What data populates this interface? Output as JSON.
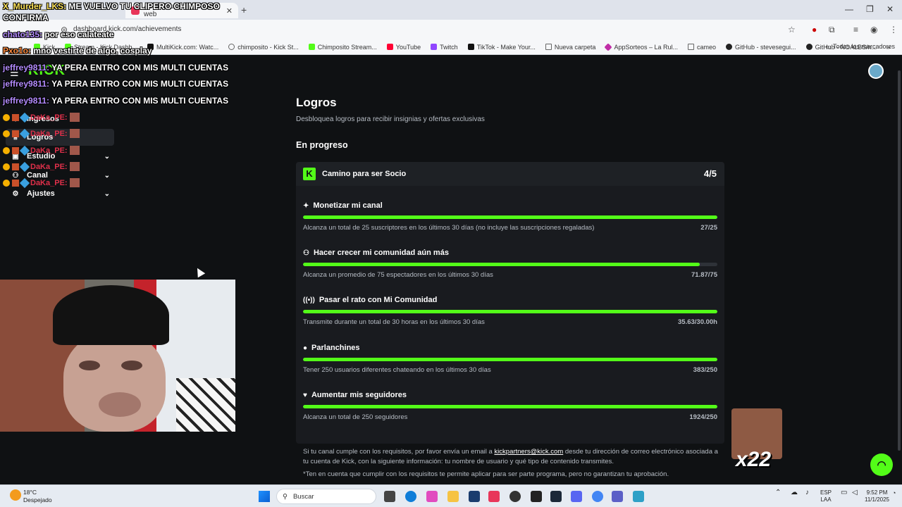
{
  "browser": {
    "active_tab_title": "Apple Music reproductor web",
    "url": "dashboard.kick.com/achievements",
    "bookmarks": [
      "Kick",
      "Stream - Kick Dashb...",
      "MultiKick.com: Watc...",
      "chimposito - Kick St...",
      "Chimposito Stream...",
      "YouTube",
      "Twitch",
      "TikTok - Make Your...",
      "Nueva carpeta",
      "AppSorteos – La Rul...",
      "cameo",
      "GitHub - stevesegui...",
      "GitHub - NOALBS/n..."
    ],
    "all_bookmarks": "Todos los marcadores"
  },
  "sidebar": {
    "items": [
      {
        "label": "Ingresos",
        "icon": "dollar-icon"
      },
      {
        "label": "Logros",
        "icon": "trophy-icon"
      },
      {
        "label": "Estudio",
        "icon": "studio-icon"
      },
      {
        "label": "Canal",
        "icon": "channel-icon"
      },
      {
        "label": "Ajustes",
        "icon": "gear-icon"
      }
    ]
  },
  "page": {
    "title": "Logros",
    "subtitle": "Desbloquea logros para recibir insignias y ofertas exclusivas",
    "section": "En progreso"
  },
  "card": {
    "title": "Camino para ser Socio",
    "count": "4/5",
    "achievements": [
      {
        "title": "Monetizar mi canal",
        "icon": "sparkle-icon",
        "desc": "Alcanza un total de 25 suscriptores en los últimos 30 días (no incluye las suscripciones regaladas)",
        "value": "27/25",
        "progress": 1.0
      },
      {
        "title": "Hacer crecer mi comunidad aún más",
        "icon": "users-icon",
        "desc": "Alcanza un promedio de 75 espectadores en los últimos 30 días",
        "value": "71.87/75",
        "progress": 0.958
      },
      {
        "title": "Pasar el rato con Mi Comunidad",
        "icon": "broadcast-icon",
        "desc": "Transmite durante un total de 30 horas en los últimos 30 días",
        "value": "35.63/30.00h",
        "progress": 1.0
      },
      {
        "title": "Parlanchines",
        "icon": "chat-bubble-icon",
        "desc": "Tener 250 usuarios diferentes chateando en los últimos 30 días",
        "value": "383/250",
        "progress": 1.0
      },
      {
        "title": "Aumentar mis seguidores",
        "icon": "heart-icon",
        "desc": "Alcanza un total de 250 seguidores",
        "value": "1924/250",
        "progress": 1.0
      }
    ]
  },
  "footer": {
    "text_before": "Si tu canal cumple con los requisitos, por favor envía un email a ",
    "email": "kickpartners@kick.com",
    "text_after": " desde tu dirección de correo electrónico asociada a tu cuenta de Kick, con la siguiente información: tu nombre de usuario y qué tipo de contenido transmites.",
    "note": "*Ten en cuenta que cumplir con los requisitos te permite aplicar para ser parte programa, pero no garantizan tu aprobación."
  },
  "overlay": {
    "top_chat": [
      {
        "user": "X_Murder_LKS:",
        "msg": "ME VUELVO TU CLIPERO CHIMPOSO"
      },
      {
        "user": "",
        "msg": "CONFIRMA"
      },
      {
        "user": "chato135:",
        "msg": "por eso calateate"
      },
      {
        "user": "Pxo1o:",
        "msg": "mno vestirte de algo, cosplay"
      }
    ],
    "chat": [
      {
        "user": "jeffrey9811:",
        "msg": "YA PERA ENTRO CON MIS MULTI CUENTAS"
      },
      {
        "user": "jeffrey9811:",
        "msg": "YA PERA ENTRO CON MIS MULTI CUENTAS"
      },
      {
        "user": "jeffrey9811:",
        "msg": "YA PERA ENTRO CON MIS MULTI CUENTAS"
      }
    ],
    "badge_user": "DaKa_PE:",
    "emote_count": "x22"
  },
  "taskbar": {
    "temp": "18°C",
    "weather": "Despejado",
    "search": "Buscar",
    "lang1": "ESP",
    "lang2": "LAA",
    "time": "9:52 PM",
    "date": "11/1/2025"
  },
  "colors": {
    "accent": "#53fc18",
    "bg": "#0f1113",
    "card": "#191b1f"
  }
}
